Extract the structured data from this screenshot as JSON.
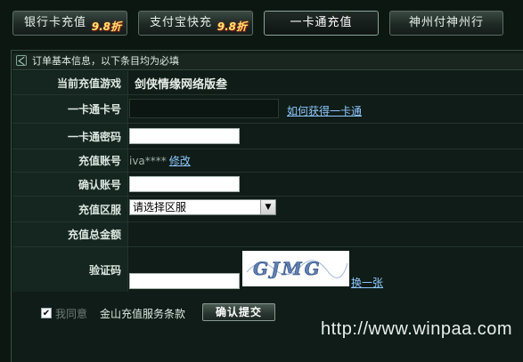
{
  "tabs": [
    {
      "label": "银行卡充值",
      "badge": "9.8折"
    },
    {
      "label": "支付宝快充",
      "badge": "9.8折"
    },
    {
      "label": "一卡通充值",
      "badge": ""
    },
    {
      "label": "神州付神州行",
      "badge": ""
    }
  ],
  "notice": "订单基本信息，以下条目均为必填",
  "form": {
    "game_label": "当前充值游戏",
    "game_value": "剑侠情缘网络版叁",
    "card_no_label": "一卡通卡号",
    "card_no_value": "",
    "card_help_link": "如何获得一卡通",
    "card_pwd_label": "一卡通密码",
    "card_pwd_value": "",
    "account_label": "充值账号",
    "account_value": "iva****",
    "account_edit_link": "修改",
    "confirm_label": "确认账号",
    "confirm_value": "",
    "server_label": "充值区服",
    "server_selected": "请选择区服",
    "total_label": "充值总金额",
    "total_value": "",
    "captcha_label": "验证码",
    "captcha_value": "",
    "captcha_text": "GJMG",
    "captcha_refresh": "换一张"
  },
  "agreement": {
    "checked": true,
    "agree_text": "我同意",
    "terms": "金山充值服务条款"
  },
  "submit_label": "确认提交",
  "watermark": "http://www.winpaa.com"
}
